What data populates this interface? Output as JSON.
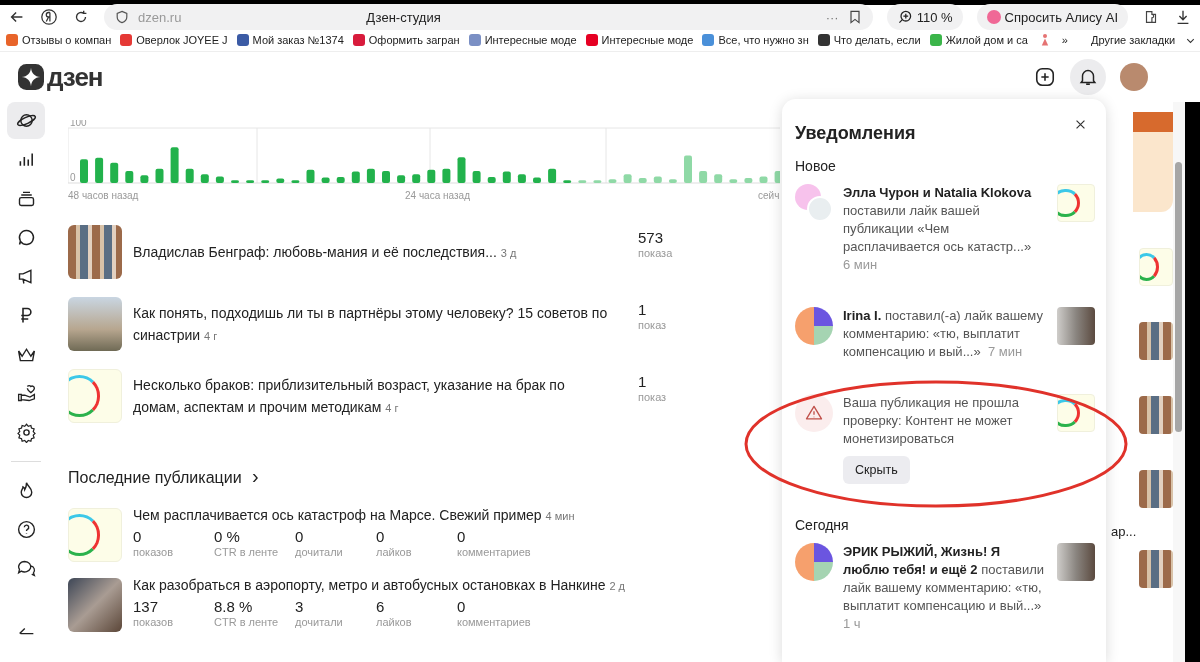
{
  "browser": {
    "address": "dzen.ru",
    "title": "Дзен-студия",
    "more": "···",
    "zoom": "110 %",
    "alice": "Спросить Алису AI",
    "bookmarks": [
      "Отзывы о компан",
      "Оверлок JOYEE J",
      "Мой заказ №1374",
      "Оформить загран",
      "Интересные моде",
      "Интересные моде",
      "Все, что нужно зн",
      "Что делать, если",
      "Жилой дом и са"
    ],
    "more_bookmarks": "»",
    "other_bookmarks": "Другие закладки"
  },
  "header": {
    "logo": "дзен",
    "bell_selected": true
  },
  "sidebar": {
    "items": [
      {
        "selected": true
      },
      {
        "selected": false
      },
      {
        "selected": false
      },
      {
        "selected": false
      },
      {
        "selected": false
      },
      {
        "selected": false
      },
      {
        "selected": false
      },
      {
        "selected": false
      },
      {
        "selected": false
      }
    ],
    "bottom_items": [
      {
        "selected": false
      },
      {
        "selected": false
      },
      {
        "selected": false
      }
    ]
  },
  "chart": {
    "x_labels": [
      "48 часов назад",
      "24 часа назад",
      "сейч"
    ],
    "chart_data": {
      "type": "bar",
      "stacked": true,
      "ylim": [
        0,
        100
      ],
      "yticks": [
        0,
        100
      ],
      "series": [
        {
          "color": "#22b24c",
          "values": [
            43,
            46,
            37,
            22,
            14,
            26,
            65,
            26,
            16,
            12,
            5,
            5,
            5,
            8,
            5,
            24,
            10,
            11,
            21,
            26,
            22,
            14,
            16,
            24,
            26,
            47,
            22,
            11,
            21,
            16,
            10,
            26,
            5,
            null,
            null,
            null,
            null,
            null,
            null,
            null,
            null,
            null,
            null,
            null,
            null,
            null,
            null
          ]
        },
        {
          "color": "#8fd9a6",
          "values": [
            null,
            null,
            null,
            null,
            null,
            null,
            null,
            null,
            null,
            null,
            null,
            null,
            null,
            null,
            null,
            null,
            null,
            null,
            null,
            null,
            null,
            null,
            null,
            null,
            null,
            null,
            null,
            null,
            null,
            null,
            null,
            null,
            null,
            5,
            5,
            7,
            16,
            9,
            12,
            7,
            50,
            22,
            16,
            7,
            9,
            12,
            22
          ]
        }
      ]
    }
  },
  "top_publications": [
    {
      "title": "Владислав Бенграф: любовь-мания и её последствия...",
      "age": "3 д",
      "count": "573",
      "count_label": "показа"
    },
    {
      "title": "Как понять, подходишь ли ты в партнёры этому человеку? 15 советов по синастрии",
      "age": "4 г",
      "count": "1",
      "count_label": "показ"
    },
    {
      "title": "Несколько браков: приблизительный возраст, указание на брак по домам, аспектам и прочим методикам",
      "age": "4 г",
      "count": "1",
      "count_label": "показ"
    }
  ],
  "latest": {
    "title": "Последние публикации",
    "arrow": "›",
    "items": [
      {
        "title": "Чем расплачивается ось катастроф на Марсе. Свежий пример",
        "age": "4 мин",
        "stats": [
          {
            "value": "0",
            "label": "показов"
          },
          {
            "value": "0 %",
            "label": "CTR в ленте"
          },
          {
            "value": "0",
            "label": "дочитали"
          },
          {
            "value": "0",
            "label": "лайков"
          },
          {
            "value": "0",
            "label": "комментариев"
          }
        ]
      },
      {
        "title": "Как разобраться в аэропорту, метро и автобусных остановках в Нанкине",
        "age": "2 д",
        "stats": [
          {
            "value": "137",
            "label": "показов"
          },
          {
            "value": "8.8 %",
            "label": "CTR в ленте"
          },
          {
            "value": "3",
            "label": "дочитали"
          },
          {
            "value": "6",
            "label": "лайков"
          },
          {
            "value": "0",
            "label": "комментариев"
          }
        ]
      }
    ]
  },
  "side_text": "ар...",
  "notifications": {
    "title": "Уведомления",
    "sections": [
      {
        "title": "Новое",
        "items": [
          {
            "kind": "like",
            "text": "**Элла Чурон и Natalia Klokova** поставили лайк вашей публикации «Чем расплачивается ось катастр...»",
            "time": "6 мин"
          },
          {
            "kind": "like",
            "text": "**Irina I.** поставил(-а) лайк вашему комментарию: «тю, выплатит компенсацию и вый...»",
            "time": "7 мин"
          },
          {
            "kind": "warning",
            "text": "Ваша публикация не прошла проверку: Контент не может монетизироваться",
            "button": "Скрыть"
          }
        ]
      },
      {
        "title": "Сегодня",
        "items": [
          {
            "kind": "like",
            "text": "**ЭРИК РЫЖИЙ, Жизнь! Я люблю тебя! и ещё 2** поставили лайк вашему комментарию: «тю, выплатит компенсацию и вый...»",
            "time": "1 ч"
          }
        ]
      }
    ]
  }
}
